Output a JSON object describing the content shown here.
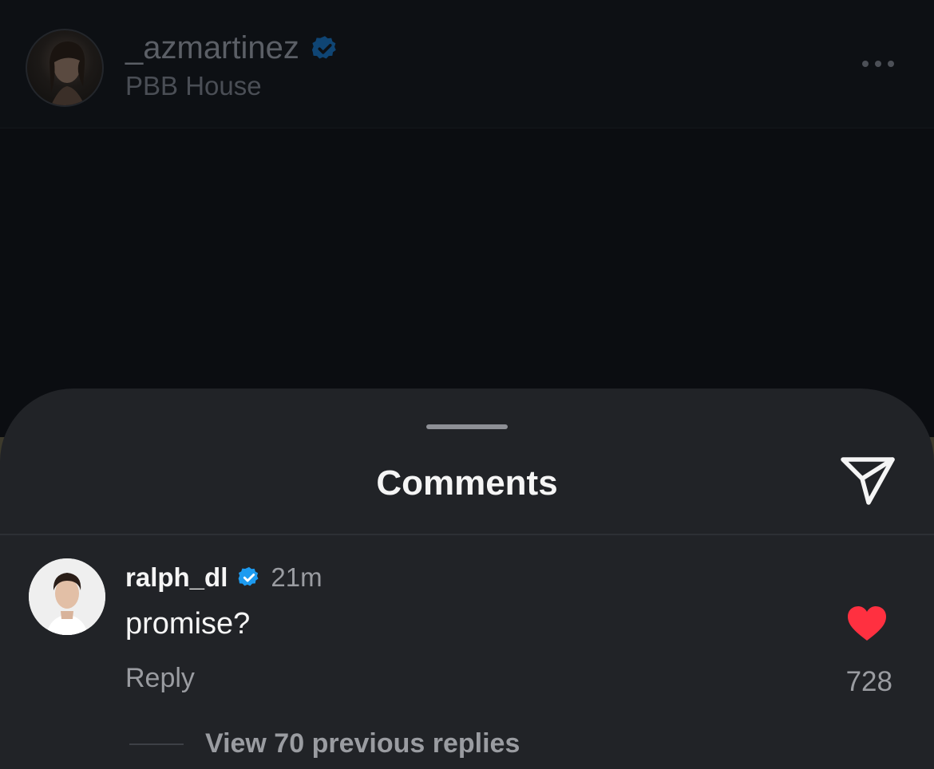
{
  "post": {
    "username": "_azmartinez",
    "location": "PBB House"
  },
  "sheet": {
    "title": "Comments"
  },
  "comment": {
    "username": "ralph_dl",
    "time": "21m",
    "text": "promise?",
    "reply_label": "Reply",
    "like_count": "728",
    "view_replies_label": "View 70 previous replies"
  },
  "icons": {
    "verified": "verified-badge-icon",
    "more": "more-horizontal-icon",
    "share": "send-icon",
    "like": "heart-filled-icon"
  },
  "colors": {
    "verified": "#1d9bf0",
    "like": "#ff3040",
    "sheet_bg": "#212327"
  }
}
